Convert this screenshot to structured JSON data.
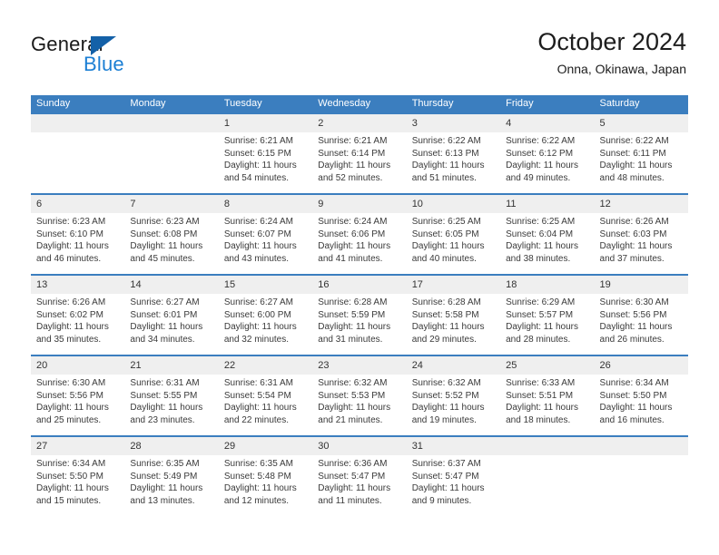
{
  "brand": {
    "name_top": "General",
    "name_bottom": "Blue",
    "triangle_color": "#1461a8",
    "blue_color": "#1c7fd4"
  },
  "header": {
    "title": "October 2024",
    "subtitle": "Onna, Okinawa, Japan"
  },
  "theme": {
    "header_blue": "#3b7ebf",
    "daynum_band": "#efefef",
    "text": "#3a3a3a"
  },
  "weekdays": [
    "Sunday",
    "Monday",
    "Tuesday",
    "Wednesday",
    "Thursday",
    "Friday",
    "Saturday"
  ],
  "weeks": [
    [
      {
        "day": "",
        "sunrise": "",
        "sunset": "",
        "daylight_line1": "",
        "daylight_line2": ""
      },
      {
        "day": "",
        "sunrise": "",
        "sunset": "",
        "daylight_line1": "",
        "daylight_line2": ""
      },
      {
        "day": "1",
        "sunrise": "Sunrise: 6:21 AM",
        "sunset": "Sunset: 6:15 PM",
        "daylight_line1": "Daylight: 11 hours",
        "daylight_line2": "and 54 minutes."
      },
      {
        "day": "2",
        "sunrise": "Sunrise: 6:21 AM",
        "sunset": "Sunset: 6:14 PM",
        "daylight_line1": "Daylight: 11 hours",
        "daylight_line2": "and 52 minutes."
      },
      {
        "day": "3",
        "sunrise": "Sunrise: 6:22 AM",
        "sunset": "Sunset: 6:13 PM",
        "daylight_line1": "Daylight: 11 hours",
        "daylight_line2": "and 51 minutes."
      },
      {
        "day": "4",
        "sunrise": "Sunrise: 6:22 AM",
        "sunset": "Sunset: 6:12 PM",
        "daylight_line1": "Daylight: 11 hours",
        "daylight_line2": "and 49 minutes."
      },
      {
        "day": "5",
        "sunrise": "Sunrise: 6:22 AM",
        "sunset": "Sunset: 6:11 PM",
        "daylight_line1": "Daylight: 11 hours",
        "daylight_line2": "and 48 minutes."
      }
    ],
    [
      {
        "day": "6",
        "sunrise": "Sunrise: 6:23 AM",
        "sunset": "Sunset: 6:10 PM",
        "daylight_line1": "Daylight: 11 hours",
        "daylight_line2": "and 46 minutes."
      },
      {
        "day": "7",
        "sunrise": "Sunrise: 6:23 AM",
        "sunset": "Sunset: 6:08 PM",
        "daylight_line1": "Daylight: 11 hours",
        "daylight_line2": "and 45 minutes."
      },
      {
        "day": "8",
        "sunrise": "Sunrise: 6:24 AM",
        "sunset": "Sunset: 6:07 PM",
        "daylight_line1": "Daylight: 11 hours",
        "daylight_line2": "and 43 minutes."
      },
      {
        "day": "9",
        "sunrise": "Sunrise: 6:24 AM",
        "sunset": "Sunset: 6:06 PM",
        "daylight_line1": "Daylight: 11 hours",
        "daylight_line2": "and 41 minutes."
      },
      {
        "day": "10",
        "sunrise": "Sunrise: 6:25 AM",
        "sunset": "Sunset: 6:05 PM",
        "daylight_line1": "Daylight: 11 hours",
        "daylight_line2": "and 40 minutes."
      },
      {
        "day": "11",
        "sunrise": "Sunrise: 6:25 AM",
        "sunset": "Sunset: 6:04 PM",
        "daylight_line1": "Daylight: 11 hours",
        "daylight_line2": "and 38 minutes."
      },
      {
        "day": "12",
        "sunrise": "Sunrise: 6:26 AM",
        "sunset": "Sunset: 6:03 PM",
        "daylight_line1": "Daylight: 11 hours",
        "daylight_line2": "and 37 minutes."
      }
    ],
    [
      {
        "day": "13",
        "sunrise": "Sunrise: 6:26 AM",
        "sunset": "Sunset: 6:02 PM",
        "daylight_line1": "Daylight: 11 hours",
        "daylight_line2": "and 35 minutes."
      },
      {
        "day": "14",
        "sunrise": "Sunrise: 6:27 AM",
        "sunset": "Sunset: 6:01 PM",
        "daylight_line1": "Daylight: 11 hours",
        "daylight_line2": "and 34 minutes."
      },
      {
        "day": "15",
        "sunrise": "Sunrise: 6:27 AM",
        "sunset": "Sunset: 6:00 PM",
        "daylight_line1": "Daylight: 11 hours",
        "daylight_line2": "and 32 minutes."
      },
      {
        "day": "16",
        "sunrise": "Sunrise: 6:28 AM",
        "sunset": "Sunset: 5:59 PM",
        "daylight_line1": "Daylight: 11 hours",
        "daylight_line2": "and 31 minutes."
      },
      {
        "day": "17",
        "sunrise": "Sunrise: 6:28 AM",
        "sunset": "Sunset: 5:58 PM",
        "daylight_line1": "Daylight: 11 hours",
        "daylight_line2": "and 29 minutes."
      },
      {
        "day": "18",
        "sunrise": "Sunrise: 6:29 AM",
        "sunset": "Sunset: 5:57 PM",
        "daylight_line1": "Daylight: 11 hours",
        "daylight_line2": "and 28 minutes."
      },
      {
        "day": "19",
        "sunrise": "Sunrise: 6:30 AM",
        "sunset": "Sunset: 5:56 PM",
        "daylight_line1": "Daylight: 11 hours",
        "daylight_line2": "and 26 minutes."
      }
    ],
    [
      {
        "day": "20",
        "sunrise": "Sunrise: 6:30 AM",
        "sunset": "Sunset: 5:56 PM",
        "daylight_line1": "Daylight: 11 hours",
        "daylight_line2": "and 25 minutes."
      },
      {
        "day": "21",
        "sunrise": "Sunrise: 6:31 AM",
        "sunset": "Sunset: 5:55 PM",
        "daylight_line1": "Daylight: 11 hours",
        "daylight_line2": "and 23 minutes."
      },
      {
        "day": "22",
        "sunrise": "Sunrise: 6:31 AM",
        "sunset": "Sunset: 5:54 PM",
        "daylight_line1": "Daylight: 11 hours",
        "daylight_line2": "and 22 minutes."
      },
      {
        "day": "23",
        "sunrise": "Sunrise: 6:32 AM",
        "sunset": "Sunset: 5:53 PM",
        "daylight_line1": "Daylight: 11 hours",
        "daylight_line2": "and 21 minutes."
      },
      {
        "day": "24",
        "sunrise": "Sunrise: 6:32 AM",
        "sunset": "Sunset: 5:52 PM",
        "daylight_line1": "Daylight: 11 hours",
        "daylight_line2": "and 19 minutes."
      },
      {
        "day": "25",
        "sunrise": "Sunrise: 6:33 AM",
        "sunset": "Sunset: 5:51 PM",
        "daylight_line1": "Daylight: 11 hours",
        "daylight_line2": "and 18 minutes."
      },
      {
        "day": "26",
        "sunrise": "Sunrise: 6:34 AM",
        "sunset": "Sunset: 5:50 PM",
        "daylight_line1": "Daylight: 11 hours",
        "daylight_line2": "and 16 minutes."
      }
    ],
    [
      {
        "day": "27",
        "sunrise": "Sunrise: 6:34 AM",
        "sunset": "Sunset: 5:50 PM",
        "daylight_line1": "Daylight: 11 hours",
        "daylight_line2": "and 15 minutes."
      },
      {
        "day": "28",
        "sunrise": "Sunrise: 6:35 AM",
        "sunset": "Sunset: 5:49 PM",
        "daylight_line1": "Daylight: 11 hours",
        "daylight_line2": "and 13 minutes."
      },
      {
        "day": "29",
        "sunrise": "Sunrise: 6:35 AM",
        "sunset": "Sunset: 5:48 PM",
        "daylight_line1": "Daylight: 11 hours",
        "daylight_line2": "and 12 minutes."
      },
      {
        "day": "30",
        "sunrise": "Sunrise: 6:36 AM",
        "sunset": "Sunset: 5:47 PM",
        "daylight_line1": "Daylight: 11 hours",
        "daylight_line2": "and 11 minutes."
      },
      {
        "day": "31",
        "sunrise": "Sunrise: 6:37 AM",
        "sunset": "Sunset: 5:47 PM",
        "daylight_line1": "Daylight: 11 hours",
        "daylight_line2": "and 9 minutes."
      },
      {
        "day": "",
        "sunrise": "",
        "sunset": "",
        "daylight_line1": "",
        "daylight_line2": ""
      },
      {
        "day": "",
        "sunrise": "",
        "sunset": "",
        "daylight_line1": "",
        "daylight_line2": ""
      }
    ]
  ]
}
